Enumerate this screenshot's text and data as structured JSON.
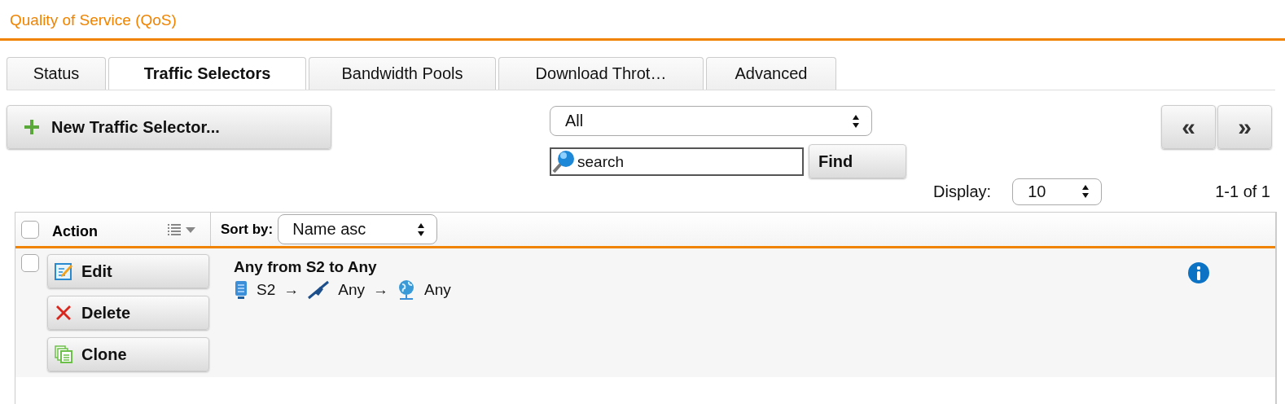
{
  "page_title": "Quality of Service (QoS)",
  "tabs": [
    {
      "label": "Status",
      "selected": false
    },
    {
      "label": "Traffic Selectors",
      "selected": true
    },
    {
      "label": "Bandwidth Pools",
      "selected": false
    },
    {
      "label": "Download Throt…",
      "selected": false
    },
    {
      "label": "Advanced",
      "selected": false
    }
  ],
  "toolbar": {
    "new_button": "New Traffic Selector...",
    "filter": {
      "value": "All"
    },
    "search": {
      "placeholder": "search"
    },
    "find_button": "Find",
    "prev_button": "«",
    "next_button": "»",
    "display_label": "Display:",
    "display_select": {
      "value": "10"
    },
    "count": "1-1 of 1"
  },
  "table": {
    "header": {
      "checked": false,
      "action_label": "Action",
      "sort_label": "Sort by:",
      "sort_select": {
        "value": "Name asc"
      }
    },
    "rows": [
      {
        "checked": false,
        "actions": [
          {
            "kind": "edit",
            "label": "Edit"
          },
          {
            "kind": "delete",
            "label": "Delete"
          },
          {
            "kind": "clone",
            "label": "Clone"
          }
        ],
        "title": "Any from S2 to Any",
        "path": [
          {
            "kind": "server",
            "label": "S2"
          },
          {
            "kind": "arrow",
            "label": "→"
          },
          {
            "kind": "link",
            "label": "Any"
          },
          {
            "kind": "arrow",
            "label": "→"
          },
          {
            "kind": "globe",
            "label": "Any"
          }
        ]
      }
    ]
  }
}
